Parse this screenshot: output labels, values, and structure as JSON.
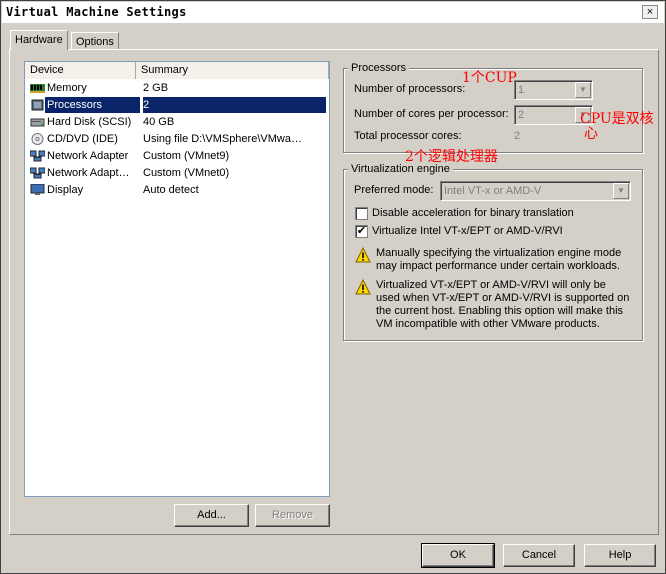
{
  "window": {
    "title": "Virtual Machine Settings",
    "close_glyph": "×"
  },
  "tabs": [
    {
      "label": "Hardware"
    },
    {
      "label": "Options"
    }
  ],
  "device_list": {
    "headers": {
      "device": "Device",
      "summary": "Summary"
    },
    "rows": [
      {
        "device": "Memory",
        "summary": "2 GB",
        "icon": "memory-icon"
      },
      {
        "device": "Processors",
        "summary": "2",
        "icon": "processor-icon"
      },
      {
        "device": "Hard Disk (SCSI)",
        "summary": "40 GB",
        "icon": "hard-disk-icon"
      },
      {
        "device": "CD/DVD (IDE)",
        "summary": "Using file D:\\VMSphere\\VMwa…",
        "icon": "cd-dvd-icon"
      },
      {
        "device": "Network Adapter",
        "summary": "Custom (VMnet9)",
        "icon": "network-adapter-icon"
      },
      {
        "device": "Network Adapt…",
        "summary": "Custom (VMnet0)",
        "icon": "network-adapter-icon"
      },
      {
        "device": "Display",
        "summary": "Auto detect",
        "icon": "display-icon"
      }
    ]
  },
  "buttons": {
    "add": "Add...",
    "remove": "Remove",
    "ok": "OK",
    "cancel": "Cancel",
    "help": "Help"
  },
  "processors": {
    "group_title": "Processors",
    "num_processors_label": "Number of processors:",
    "num_processors_value": "1",
    "cores_label": "Number of cores per processor:",
    "cores_value": "2",
    "total_label": "Total processor cores:",
    "total_value": "2"
  },
  "virtualization": {
    "group_title": "Virtualization engine",
    "mode_label": "Preferred mode:",
    "mode_value": "Intel VT-x or AMD-V",
    "disable_accel_label": "Disable acceleration for binary translation",
    "disable_accel_checked": false,
    "virtualize_label": "Virtualize Intel VT-x/EPT or AMD-V/RVI",
    "virtualize_checked": true,
    "check_glyph": "✔",
    "warning1": "Manually specifying the virtualization engine mode may impact performance under certain workloads.",
    "warning2": "Virtualized VT-x/EPT or AMD-V/RVI will only be used when VT-x/EPT or AMD-V/RVI is supported on the current host. Enabling this option will make this VM incompatible with other VMware products."
  },
  "annotations": {
    "one_cpu": "1个CUP",
    "dual_core": "CPU是双核",
    "dual_core_2": "心",
    "two_logical": "2个逻辑处理器"
  },
  "colors": {
    "selection": "#0a246a",
    "annotation": "#ff0000",
    "dialog_bg": "#d4d0c8"
  }
}
